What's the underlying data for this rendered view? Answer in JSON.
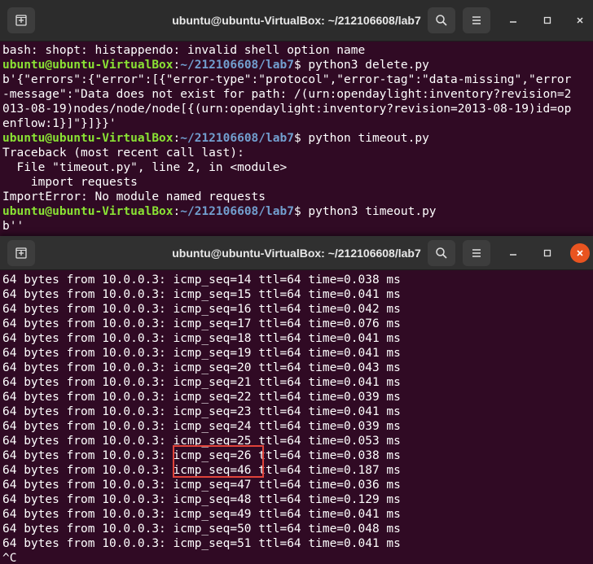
{
  "window_top": {
    "title": "ubuntu@ubuntu-VirtualBox: ~/212106608/lab7",
    "icons": [
      "new-tab-icon",
      "search-icon",
      "menu-icon",
      "minimize-icon",
      "maximize-icon",
      "close-icon"
    ],
    "lines": [
      {
        "text": "bash: shopt: histappendo: invalid shell option name"
      },
      {
        "prompt_user": "ubuntu@ubuntu-VirtualBox",
        "prompt_colon": ":",
        "prompt_path": "~/212106608/lab7",
        "prompt_symbol": "$ ",
        "cmd": "python3 delete.py"
      },
      {
        "text": "b'{\"errors\":{\"error\":[{\"error-type\":\"protocol\",\"error-tag\":\"data-missing\",\"error"
      },
      {
        "text": "-message\":\"Data does not exist for path: /(urn:opendaylight:inventory?revision=2"
      },
      {
        "text": "013-08-19)nodes/node/node[{(urn:opendaylight:inventory?revision=2013-08-19)id=op"
      },
      {
        "text": "enflow:1}]\"}]}}'"
      },
      {
        "prompt_user": "ubuntu@ubuntu-VirtualBox",
        "prompt_colon": ":",
        "prompt_path": "~/212106608/lab7",
        "prompt_symbol": "$ ",
        "cmd": "python timeout.py"
      },
      {
        "text": "Traceback (most recent call last):"
      },
      {
        "text": "  File \"timeout.py\", line 2, in <module>"
      },
      {
        "text": "    import requests"
      },
      {
        "text": "ImportError: No module named requests"
      },
      {
        "prompt_user": "ubuntu@ubuntu-VirtualBox",
        "prompt_colon": ":",
        "prompt_path": "~/212106608/lab7",
        "prompt_symbol": "$ ",
        "cmd": "python3 timeout.py"
      },
      {
        "text": "b''"
      }
    ]
  },
  "window_bottom": {
    "title": "ubuntu@ubuntu-VirtualBox: ~/212106608/lab7",
    "icons": [
      "new-tab-icon",
      "search-icon",
      "menu-icon",
      "minimize-icon",
      "maximize-icon",
      "close-icon"
    ],
    "lines": [
      "64 bytes from 10.0.0.3: icmp_seq=14 ttl=64 time=0.038 ms",
      "64 bytes from 10.0.0.3: icmp_seq=15 ttl=64 time=0.041 ms",
      "64 bytes from 10.0.0.3: icmp_seq=16 ttl=64 time=0.042 ms",
      "64 bytes from 10.0.0.3: icmp_seq=17 ttl=64 time=0.076 ms",
      "64 bytes from 10.0.0.3: icmp_seq=18 ttl=64 time=0.041 ms",
      "64 bytes from 10.0.0.3: icmp_seq=19 ttl=64 time=0.041 ms",
      "64 bytes from 10.0.0.3: icmp_seq=20 ttl=64 time=0.043 ms",
      "64 bytes from 10.0.0.3: icmp_seq=21 ttl=64 time=0.041 ms",
      "64 bytes from 10.0.0.3: icmp_seq=22 ttl=64 time=0.039 ms",
      "64 bytes from 10.0.0.3: icmp_seq=23 ttl=64 time=0.041 ms",
      "64 bytes from 10.0.0.3: icmp_seq=24 ttl=64 time=0.039 ms",
      "64 bytes from 10.0.0.3: icmp_seq=25 ttl=64 time=0.053 ms",
      "64 bytes from 10.0.0.3: icmp_seq=26 ttl=64 time=0.038 ms",
      "64 bytes from 10.0.0.3: icmp_seq=46 ttl=64 time=0.187 ms",
      "64 bytes from 10.0.0.3: icmp_seq=47 ttl=64 time=0.036 ms",
      "64 bytes from 10.0.0.3: icmp_seq=48 ttl=64 time=0.129 ms",
      "64 bytes from 10.0.0.3: icmp_seq=49 ttl=64 time=0.041 ms",
      "64 bytes from 10.0.0.3: icmp_seq=50 ttl=64 time=0.048 ms",
      "64 bytes from 10.0.0.3: icmp_seq=51 ttl=64 time=0.041 ms",
      "^C"
    ]
  },
  "colors": {
    "terminal_bg": "#300a24",
    "titlebar_bg": "#2c2c2c",
    "prompt_user": "#8ae234",
    "prompt_path": "#729fcf",
    "close_button": "#e95420",
    "highlight": "#e0433a"
  }
}
